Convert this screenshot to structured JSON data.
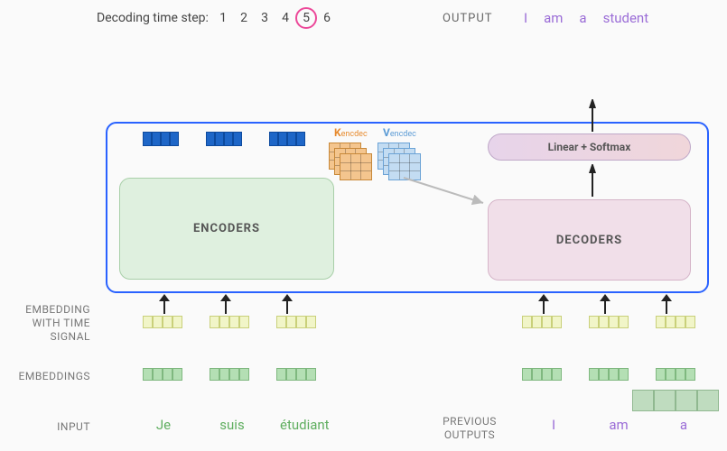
{
  "header": {
    "timestep_label": "Decoding time step:",
    "steps": [
      "1",
      "2",
      "3",
      "4",
      "5",
      "6"
    ],
    "current_step_index": 4,
    "output_label": "OUTPUT",
    "output_tokens": [
      "I",
      "am",
      "a",
      "student"
    ]
  },
  "kv": {
    "k_label": "K",
    "k_sub": "encdec",
    "v_label": "V",
    "v_sub": "encdec"
  },
  "boxes": {
    "encoders": "ENCODERS",
    "decoders": "DECODERS",
    "linsoft": "Linear + Softmax"
  },
  "labels": {
    "emb_ts": "EMBEDDING WITH TIME SIGNAL",
    "emb": "EMBEDDINGS",
    "input": "INPUT",
    "prev": "PREVIOUS OUTPUTS"
  },
  "inputs": {
    "encoder": [
      "Je",
      "suis",
      "étudiant"
    ],
    "decoder": [
      "I",
      "am",
      "a"
    ]
  }
}
